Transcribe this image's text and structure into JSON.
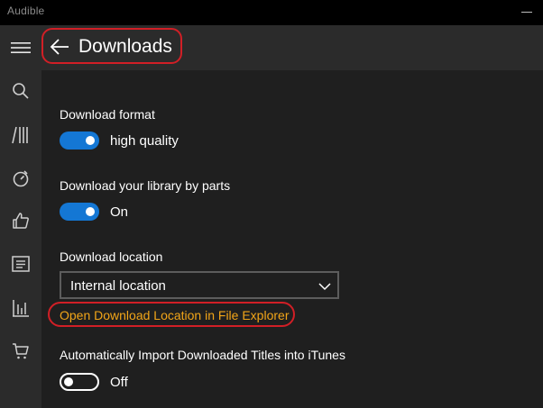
{
  "app": {
    "title": "Audible"
  },
  "sidebar": {
    "items": [
      {
        "icon": "hamburger-menu-icon"
      },
      {
        "icon": "search-icon"
      },
      {
        "icon": "library-icon"
      },
      {
        "icon": "timer-icon"
      },
      {
        "icon": "thumbs-up-icon"
      },
      {
        "icon": "list-icon"
      },
      {
        "icon": "stats-icon"
      },
      {
        "icon": "cart-icon"
      }
    ]
  },
  "header": {
    "title": "Downloads",
    "back_icon": "back-arrow-icon"
  },
  "settings": {
    "download_format": {
      "label": "Download format",
      "toggle_on": true,
      "toggle_text": "high quality"
    },
    "download_by_parts": {
      "label": "Download your library by parts",
      "toggle_on": true,
      "toggle_text": "On"
    },
    "download_location": {
      "label": "Download location",
      "selected": "Internal location",
      "link_text": "Open Download Location in File Explorer"
    },
    "itunes_import": {
      "label": "Automatically Import Downloaded Titles into iTunes",
      "toggle_on": false,
      "toggle_text": "Off"
    }
  },
  "colors": {
    "accent": "#1477d4",
    "link": "#f2a518",
    "annotation": "#d11f26",
    "sidebar_bg": "#2b2b2b",
    "content_bg": "#1f1f1f"
  }
}
